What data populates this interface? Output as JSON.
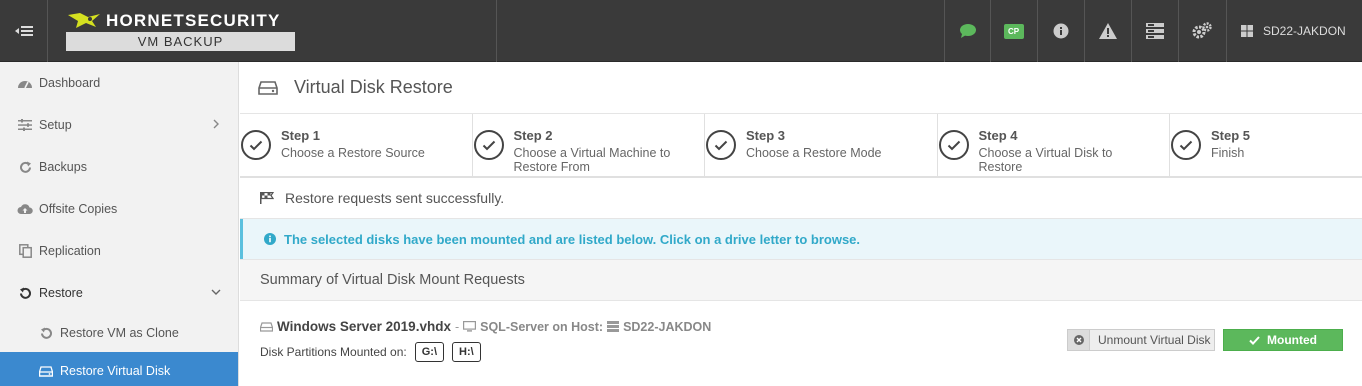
{
  "topbar": {
    "brand": "HORNETSECURITY",
    "product": "VM BACKUP",
    "cp_label": "CP",
    "user": "SD22-JAKDON",
    "icons": [
      "sidebar-toggle-icon",
      "chat-icon",
      "cp-icon",
      "info-icon",
      "warning-icon",
      "server-icon",
      "settings-icon",
      "windows-icon"
    ]
  },
  "sidebar": {
    "items": [
      {
        "label": "Dashboard",
        "icon": "dashboard-icon"
      },
      {
        "label": "Setup",
        "icon": "sliders-icon"
      },
      {
        "label": "Backups",
        "icon": "refresh-icon"
      },
      {
        "label": "Offsite Copies",
        "icon": "cloud-upload-icon"
      },
      {
        "label": "Replication",
        "icon": "copy-icon"
      },
      {
        "label": "Restore",
        "icon": "undo-icon"
      },
      {
        "label": "Restore VM as Clone",
        "icon": "undo-icon"
      },
      {
        "label": "Restore Virtual Disk",
        "icon": "disk-icon"
      }
    ]
  },
  "main": {
    "title": "Virtual Disk Restore",
    "steps": [
      {
        "title": "Step 1",
        "desc": "Choose a Restore Source"
      },
      {
        "title": "Step 2",
        "desc": "Choose a Virtual Machine to Restore From"
      },
      {
        "title": "Step 3",
        "desc": "Choose a Restore Mode"
      },
      {
        "title": "Step 4",
        "desc": "Choose a Virtual Disk to Restore"
      },
      {
        "title": "Step 5",
        "desc": "Finish"
      }
    ],
    "status": "Restore requests sent successfully.",
    "alert": "The selected disks have been mounted and are listed below. Click on a drive letter to browse.",
    "summary_title": "Summary of Virtual Disk Mount Requests",
    "disk": {
      "name": "Windows Server 2019.vhdx",
      "separator": "-",
      "vm": "SQL-Server on Host:",
      "host": "SD22-JAKDON",
      "partitions_label": "Disk Partitions Mounted on:",
      "drives": [
        "G:\\",
        "H:\\"
      ],
      "unmount_label": "Unmount Virtual Disk",
      "mounted_label": "Mounted"
    }
  },
  "colors": {
    "topbar": "#3a3a3a",
    "active": "#3b89cf",
    "success": "#5cb85c",
    "info": "#31a9c9"
  }
}
